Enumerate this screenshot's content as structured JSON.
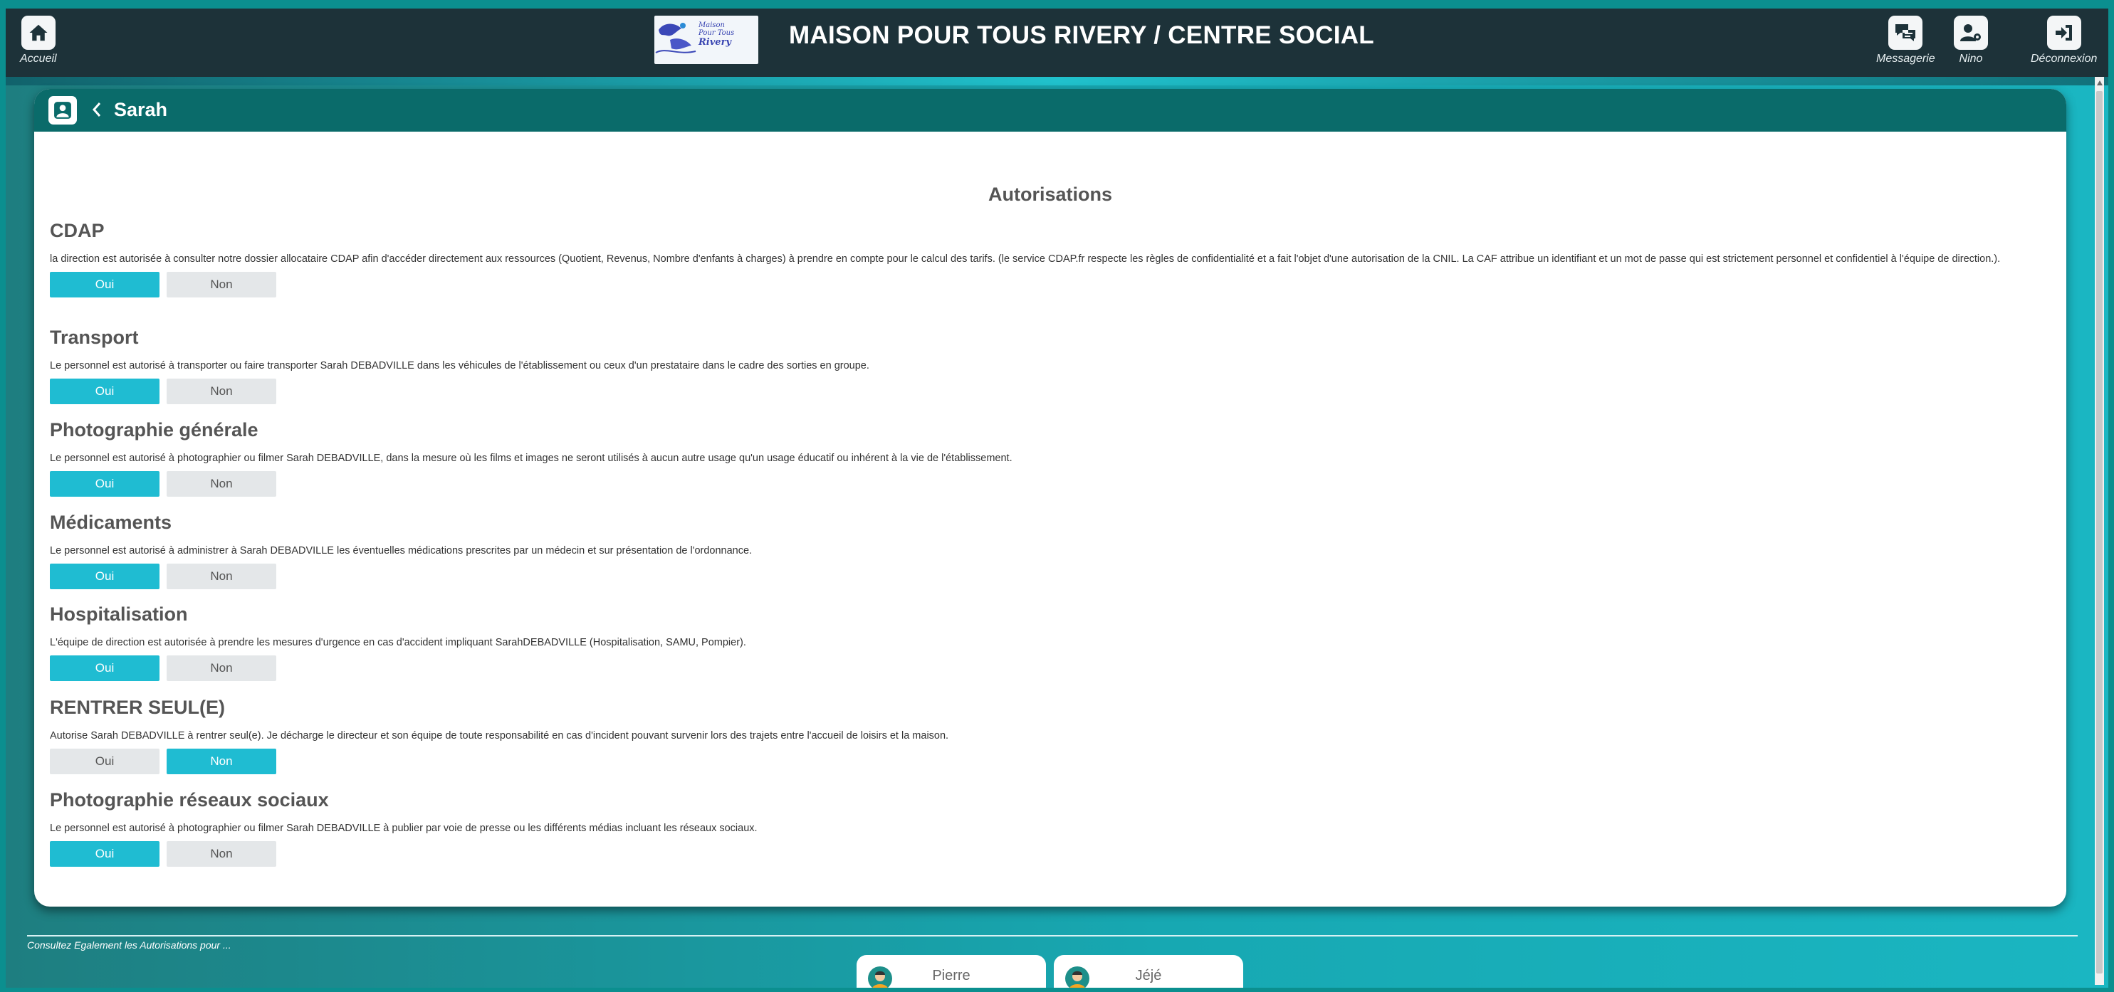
{
  "header": {
    "home_label": "Accueil",
    "title": "MAISON POUR TOUS RIVERY / CENTRE SOCIAL",
    "logo_text": [
      "Maison",
      "Pour Tous",
      "Rivery"
    ],
    "actions": [
      {
        "label": "Messagerie",
        "icon": "chat-icon"
      },
      {
        "label": "Nino",
        "icon": "user-settings-icon"
      },
      {
        "label": "Déconnexion",
        "icon": "logout-icon"
      }
    ]
  },
  "card": {
    "child_name": "Sarah",
    "section_title": "Autorisations"
  },
  "authorizations": [
    {
      "title": "CDAP",
      "text": "la direction est autorisée à consulter notre dossier allocataire CDAP afin d'accéder directement aux ressources (Quotient, Revenus, Nombre d'enfants à charges) à prendre en compte pour le calcul des tarifs. (le service CDAP.fr respecte les règles de confidentialité et a fait l'objet d'une autorisation de la CNIL. La CAF attribue un identifiant et un mot de passe qui est strictement personnel et confidentiel à l'équipe de direction.).",
      "yes": "Oui",
      "no": "Non",
      "value": "Oui"
    },
    {
      "title": "Transport",
      "text": "Le personnel est autorisé à transporter ou faire transporter Sarah DEBADVILLE dans les véhicules de l'établissement ou ceux d'un prestataire dans le cadre des sorties en groupe.",
      "yes": "Oui",
      "no": "Non",
      "value": "Oui"
    },
    {
      "title": "Photographie générale",
      "text": "Le personnel est autorisé à photographier ou filmer Sarah DEBADVILLE, dans la mesure où les films et images ne seront utilisés à aucun autre usage qu'un usage éducatif ou inhérent à la vie de l'établissement.",
      "yes": "Oui",
      "no": "Non",
      "value": "Oui"
    },
    {
      "title": "Médicaments",
      "text": "Le personnel est autorisé à administrer à Sarah DEBADVILLE les éventuelles médications prescrites par un médecin et sur présentation de l'ordonnance.",
      "yes": "Oui",
      "no": "Non",
      "value": "Oui"
    },
    {
      "title": "Hospitalisation",
      "text": "L'équipe de direction est autorisée à prendre les mesures d'urgence en cas d'accident impliquant SarahDEBADVILLE (Hospitalisation, SAMU, Pompier).",
      "yes": "Oui",
      "no": "Non",
      "value": "Oui"
    },
    {
      "title": "RENTRER SEUL(E)",
      "text": "Autorise Sarah DEBADVILLE à rentrer seul(e). Je décharge le directeur et son équipe de toute responsabilité en cas d'incident pouvant survenir lors des trajets entre l'accueil de loisirs et la maison.",
      "yes": "Oui",
      "no": "Non",
      "value": "Non"
    },
    {
      "title": "Photographie réseaux sociaux",
      "text": "Le personnel est autorisé à photographier ou filmer Sarah DEBADVILLE à publier par voie de presse ou les différents médias incluant les réseaux sociaux.",
      "yes": "Oui",
      "no": "Non",
      "value": "Oui"
    }
  ],
  "footer": {
    "also_label": "Consultez Egalement les Autorisations pour ...",
    "siblings": [
      {
        "name": "Pierre"
      },
      {
        "name": "Jéjé"
      }
    ]
  },
  "colors": {
    "header_bg": "#1d3239",
    "card_header": "#0a6b6a",
    "active_button": "#1fbcd2",
    "inactive_button": "#e4e7e9"
  }
}
